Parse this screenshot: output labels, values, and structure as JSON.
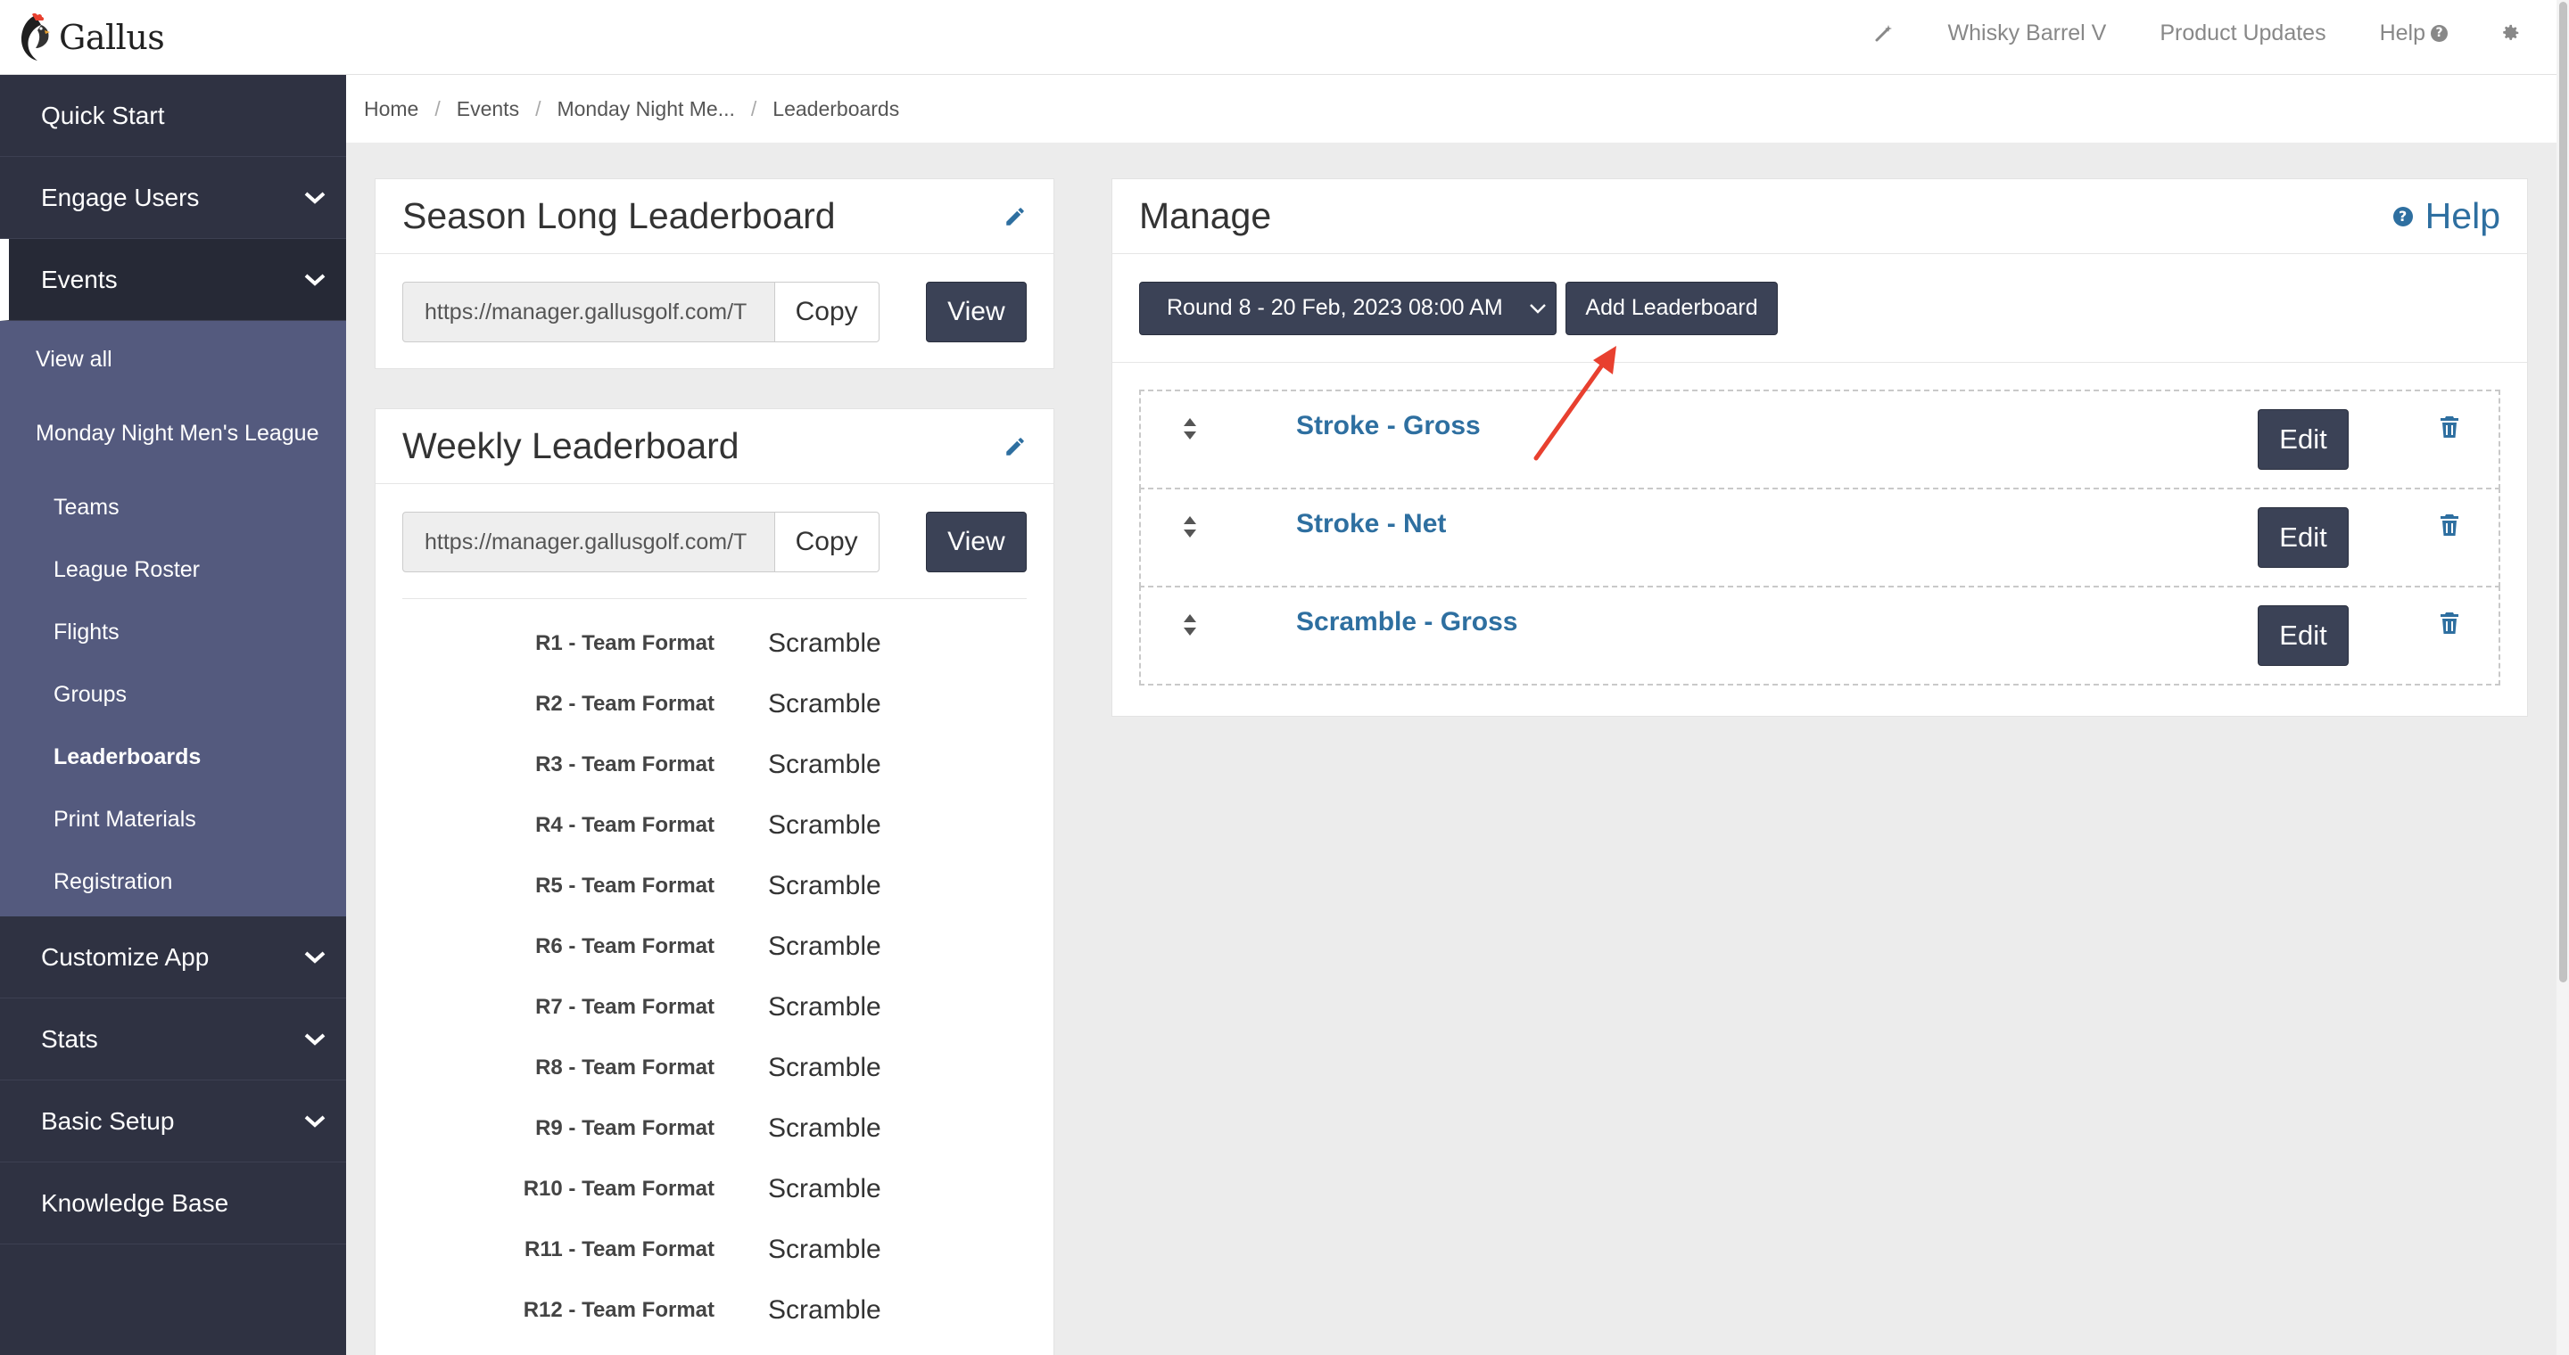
{
  "brand": {
    "name": "Gallus"
  },
  "topnav": {
    "course": "Whisky Barrel V",
    "updates": "Product Updates",
    "help": "Help"
  },
  "sidebar": {
    "quick_start": "Quick Start",
    "engage_users": "Engage Users",
    "events": "Events",
    "events_sub": {
      "view_all": "View all",
      "league": "Monday Night Men's League",
      "teams": "Teams",
      "roster": "League Roster",
      "flights": "Flights",
      "groups": "Groups",
      "leaderboards": "Leaderboards",
      "print": "Print Materials",
      "registration": "Registration"
    },
    "customize_app": "Customize App",
    "stats": "Stats",
    "basic_setup": "Basic Setup",
    "knowledge_base": "Knowledge Base"
  },
  "breadcrumb": {
    "home": "Home",
    "events": "Events",
    "event": "Monday Night Me...",
    "current": "Leaderboards"
  },
  "season": {
    "title": "Season Long Leaderboard",
    "url": "https://manager.gallusgolf.com/T",
    "copy": "Copy",
    "view": "View"
  },
  "weekly": {
    "title": "Weekly Leaderboard",
    "url": "https://manager.gallusgolf.com/T",
    "copy": "Copy",
    "view": "View",
    "formats": [
      {
        "label": "R1 - Team Format",
        "value": "Scramble"
      },
      {
        "label": "R2 - Team Format",
        "value": "Scramble"
      },
      {
        "label": "R3 - Team Format",
        "value": "Scramble"
      },
      {
        "label": "R4 - Team Format",
        "value": "Scramble"
      },
      {
        "label": "R5 - Team Format",
        "value": "Scramble"
      },
      {
        "label": "R6 - Team Format",
        "value": "Scramble"
      },
      {
        "label": "R7 - Team Format",
        "value": "Scramble"
      },
      {
        "label": "R8 - Team Format",
        "value": "Scramble"
      },
      {
        "label": "R9 - Team Format",
        "value": "Scramble"
      },
      {
        "label": "R10 - Team Format",
        "value": "Scramble"
      },
      {
        "label": "R11 - Team Format",
        "value": "Scramble"
      },
      {
        "label": "R12 - Team Format",
        "value": "Scramble"
      }
    ]
  },
  "manage": {
    "title": "Manage",
    "help": "Help",
    "round_selected": "Round 8 - 20 Feb, 2023 08:00 AM",
    "add_button": "Add Leaderboard",
    "edit_label": "Edit",
    "leaderboards": [
      {
        "name": "Stroke - Gross"
      },
      {
        "name": "Stroke - Net"
      },
      {
        "name": "Scramble - Gross"
      }
    ]
  },
  "colors": {
    "sidebar_bg": "#2f3242",
    "submenu_bg": "#545a7e",
    "button_dark": "#3b4256",
    "link_blue": "#2e6fa0",
    "annotation_red": "#e8402f"
  }
}
